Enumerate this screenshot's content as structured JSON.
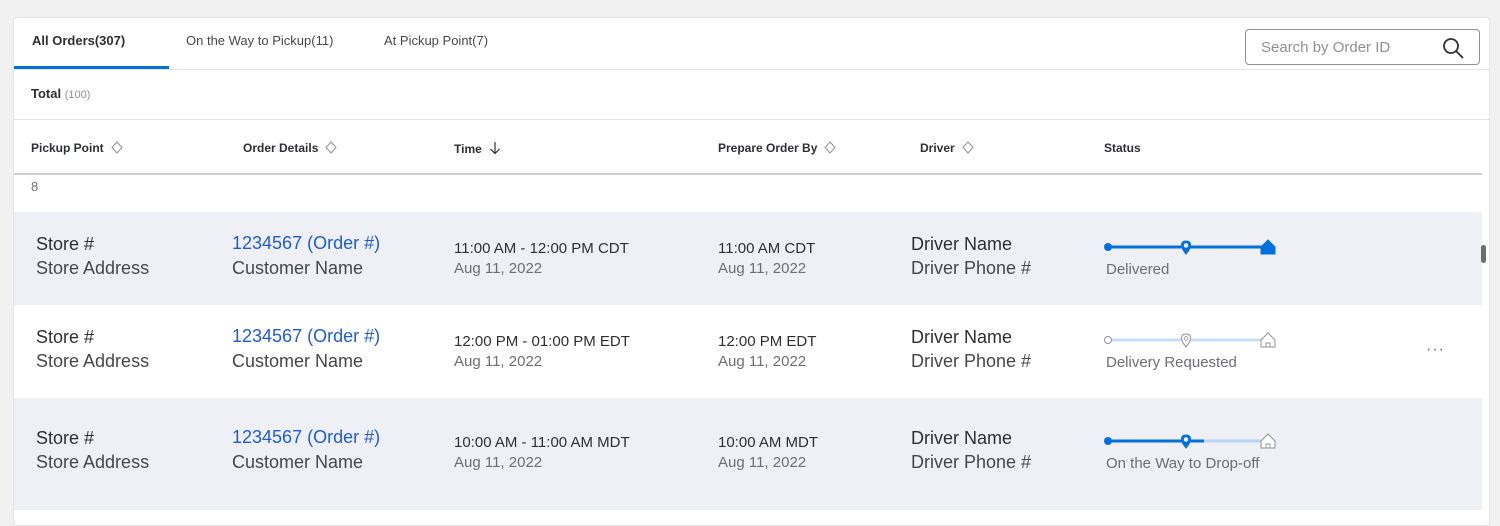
{
  "tabs": [
    {
      "label": "All Orders(307)",
      "active": true
    },
    {
      "label": "On the Way to Pickup(11)",
      "active": false
    },
    {
      "label": "At Pickup Point(7)",
      "active": false
    }
  ],
  "search": {
    "placeholder": "Search by Order ID",
    "icon": "search-icon"
  },
  "total": {
    "label": "Total",
    "count": "(100)"
  },
  "columns": {
    "pickup_point": "Pickup Point",
    "order_details": "Order Details",
    "time": "Time",
    "prepare_order_by": "Prepare Order By",
    "driver": "Driver",
    "status": "Status"
  },
  "partial_row_text": "8",
  "rows": [
    {
      "store": "Store #",
      "address": "Store Address",
      "order": "1234567 (Order #)",
      "customer": "Customer Name",
      "time_range": "11:00 AM - 12:00 PM CDT",
      "time_date": "Aug 11, 2022",
      "prepare_time": "11:00 AM CDT",
      "prepare_date": "Aug 11, 2022",
      "driver_name": "Driver Name",
      "driver_phone": "Driver Phone #",
      "status": "Delivered",
      "progress": 1.0
    },
    {
      "store": "Store #",
      "address": "Store Address",
      "order": "1234567 (Order #)",
      "customer": "Customer Name",
      "time_range": "12:00 PM - 01:00 PM EDT",
      "time_date": "Aug 11, 2022",
      "prepare_time": "12:00 PM EDT",
      "prepare_date": "Aug 11, 2022",
      "driver_name": "Driver Name",
      "driver_phone": "Driver Phone #",
      "status": "Delivery Requested",
      "progress": 0.0
    },
    {
      "store": "Store #",
      "address": "Store Address",
      "order": "1234567 (Order #)",
      "customer": "Customer Name",
      "time_range": "10:00 AM - 11:00 AM MDT",
      "time_date": "Aug 11, 2022",
      "prepare_time": "10:00 AM MDT",
      "prepare_date": "Aug 11, 2022",
      "driver_name": "Driver Name",
      "driver_phone": "Driver Phone #",
      "status": "On the Way to Drop-off",
      "progress": 0.6
    }
  ],
  "row_actions": "···",
  "colors": {
    "accent": "#0071dc",
    "link": "#1f5bd6",
    "track_inactive": "#b9d4f5",
    "shaded_row": "#eef0f5"
  }
}
